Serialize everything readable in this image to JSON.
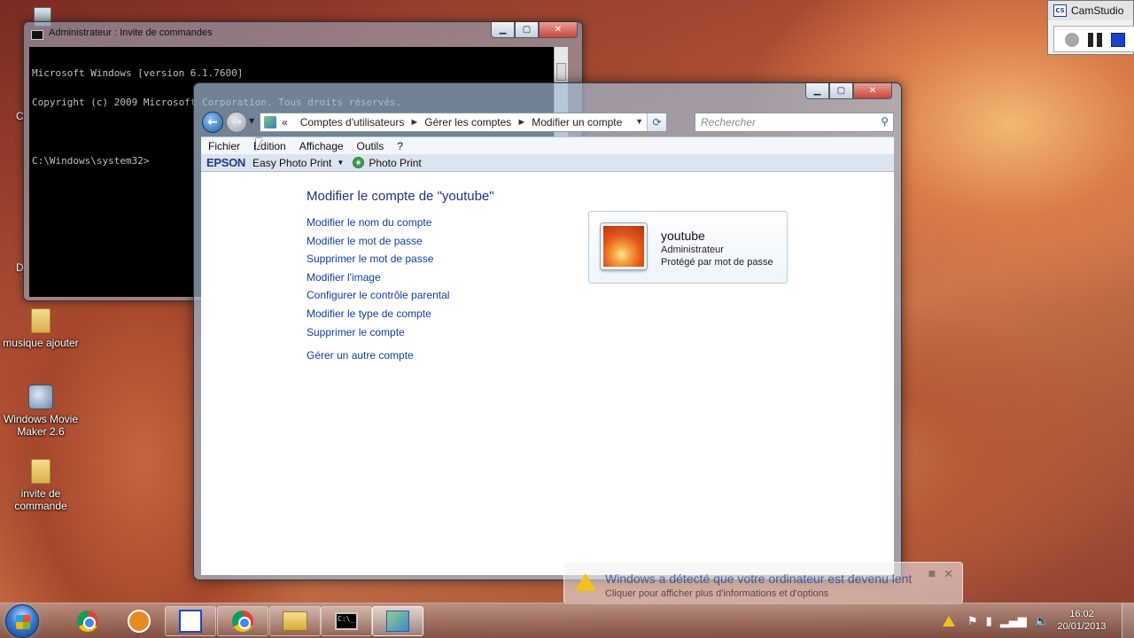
{
  "desktop": {
    "icons": [
      {
        "label": "musique ajouter"
      },
      {
        "label": "Windows Movie Maker 2.6"
      },
      {
        "label": "invite de commande"
      }
    ],
    "clipped_labels": [
      "C",
      "D"
    ]
  },
  "cmd_window": {
    "title": "Administrateur : Invite de commandes",
    "lines": [
      "Microsoft Windows [version 6.1.7600]",
      "Copyright (c) 2009 Microsoft Corporation. Tous droits réservés.",
      "",
      "C:\\Windows\\system32>"
    ]
  },
  "explorer": {
    "breadcrumb": {
      "overflow": "«",
      "items": [
        "Comptes d'utilisateurs",
        "Gérer les comptes",
        "Modifier un compte"
      ],
      "separator": "►"
    },
    "search_placeholder": "Rechercher",
    "menu": [
      "Fichier",
      "Edition",
      "Affichage",
      "Outils",
      "?"
    ],
    "epson_toolbar": {
      "logo": "EPSON",
      "easy_photo_print": "Easy Photo Print",
      "photo_print": "Photo Print"
    },
    "page_title": "Modifier le compte de \"youtube\"",
    "tasks": [
      "Modifier le nom du compte",
      "Modifier le mot de passe",
      "Supprimer le mot de passe",
      "Modifier l'image",
      "Configurer le contrôle parental",
      "Modifier le type de compte",
      "Supprimer le compte"
    ],
    "other_task": "Gérer un autre compte",
    "account": {
      "name": "youtube",
      "type": "Administrateur",
      "status": "Protégé par mot de passe"
    }
  },
  "camstudio": {
    "title": "CamStudio"
  },
  "notification": {
    "title": "Windows a détecté que votre ordinateur est devenu lent",
    "subtitle": "Cliquer pour afficher plus d'informations et d'options"
  },
  "taskbar": {
    "clock_time": "16:02",
    "clock_date": "20/01/2013"
  }
}
